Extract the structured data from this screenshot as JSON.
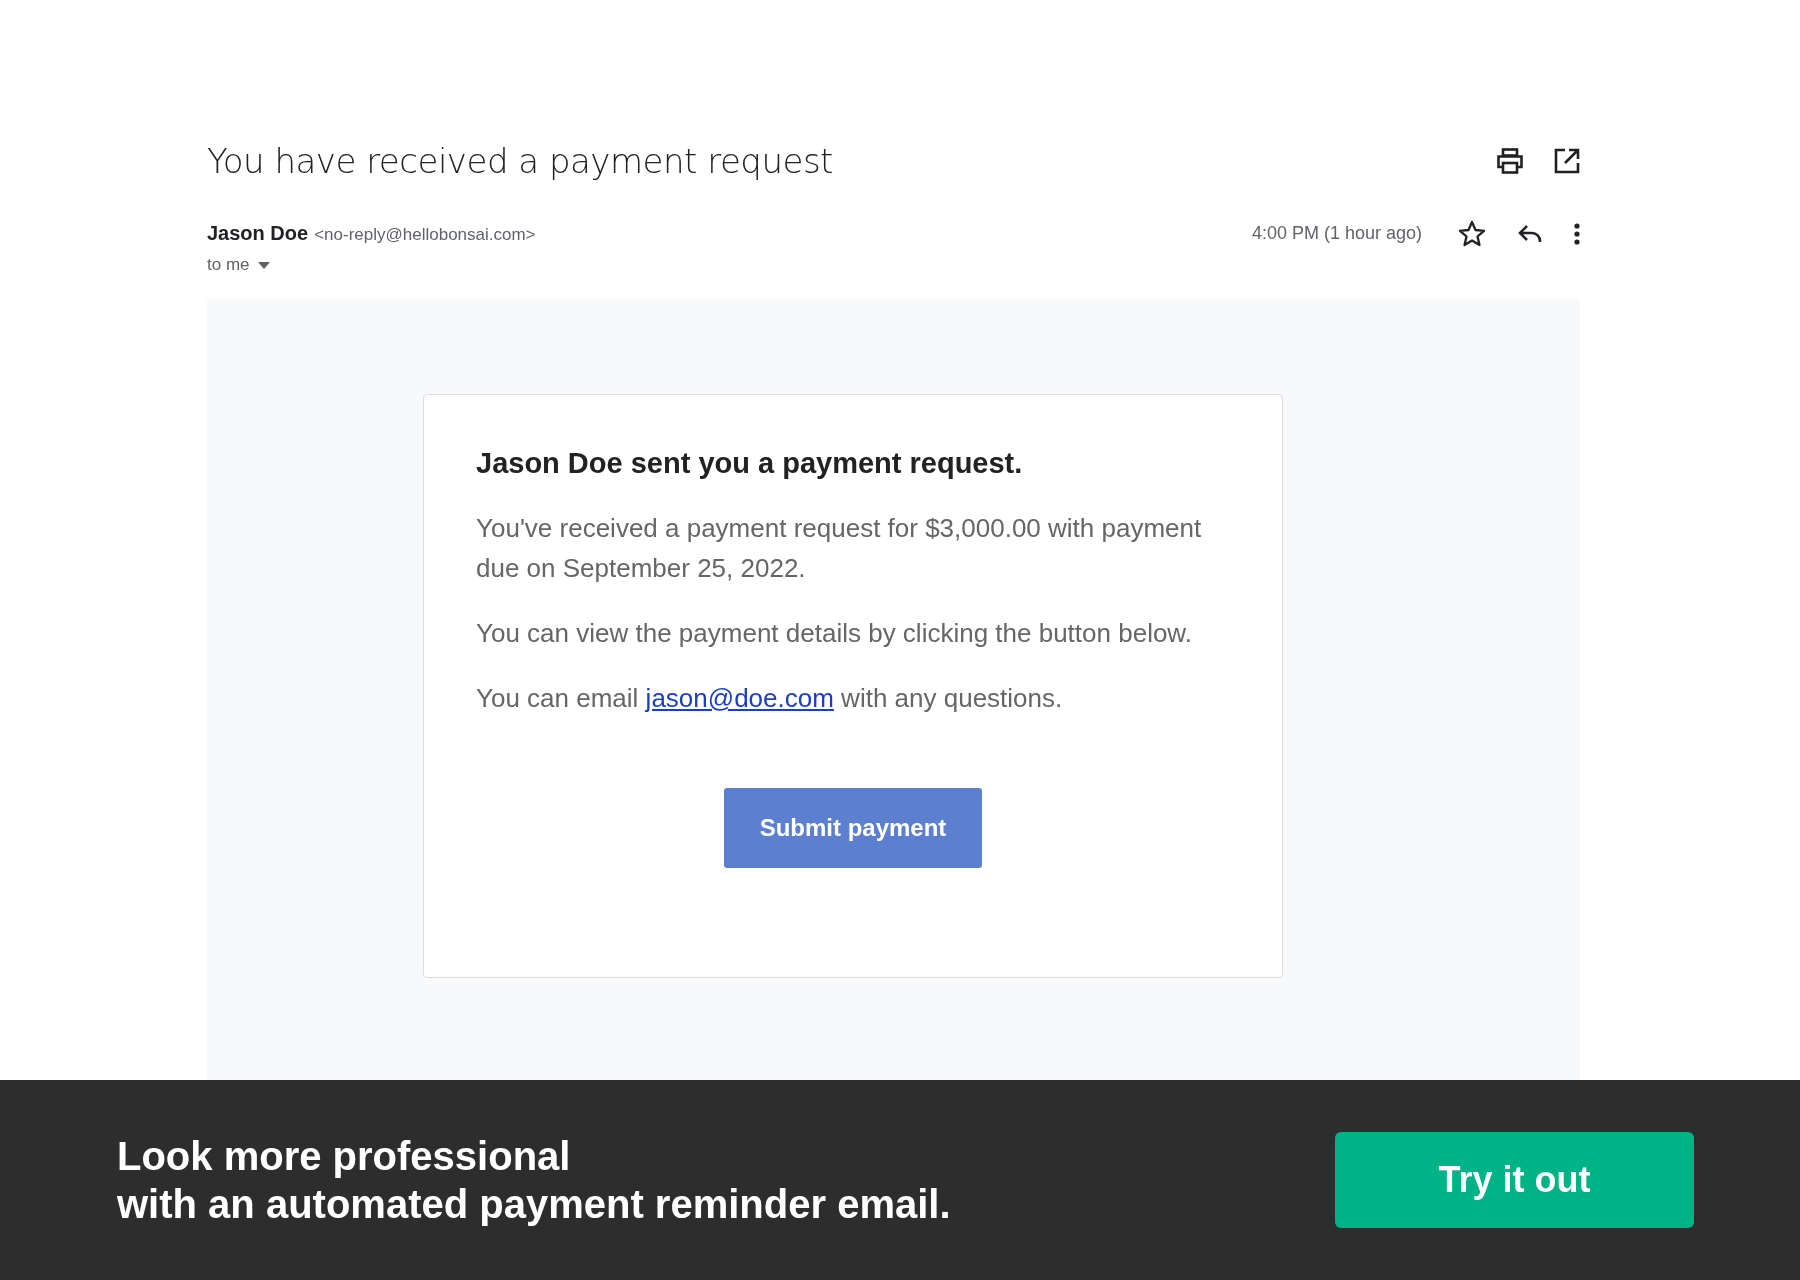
{
  "email": {
    "subject": "You have received a payment request",
    "sender_name": "Jason Doe",
    "sender_address": "<no-reply@hellobonsai.com>",
    "recipient": "to me",
    "time": "4:00 PM (1 hour ago)",
    "starred": false,
    "body": {
      "heading": "Jason Doe sent you a payment request.",
      "paragraphs": [
        "You've received a payment request for $3,000.00 with payment due on September 25, 2022.",
        "You can view the payment details by clicking the button below."
      ],
      "contact": {
        "before": "You can email ",
        "link": "jason@doe.com",
        "after": " with any questions."
      },
      "button": "Submit payment"
    }
  },
  "banner": {
    "lines": [
      "Look more professional",
      "with an automated payment reminder email."
    ],
    "button": "Try it out"
  }
}
